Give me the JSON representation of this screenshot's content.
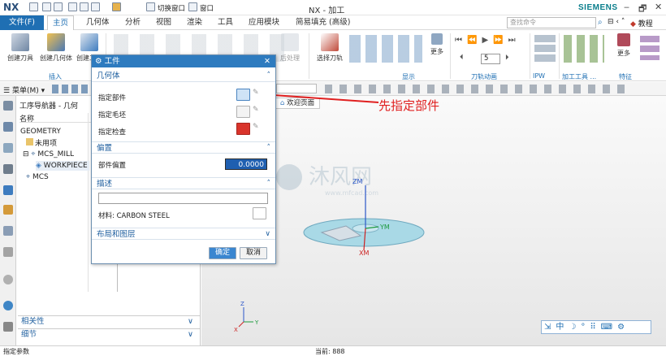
{
  "app": {
    "logo": "NX",
    "title": "NX - 加工",
    "brand": "SIEMENS",
    "quick_access": {
      "switch_window": "切换窗口",
      "window": "窗口"
    },
    "window_controls": [
      "‒",
      "🗗",
      "✕"
    ]
  },
  "menubar": {
    "tabs": [
      "文件(F)",
      "主页",
      "几何体",
      "分析",
      "视图",
      "渲染",
      "工具",
      "应用模块",
      "简易填充 (高级)"
    ],
    "search_placeholder": "查找命令",
    "tutorial": "教程"
  },
  "ribbon": {
    "buttons": [
      "创建刀具",
      "创建几何体",
      "创建工序",
      "后处理",
      "选择刀轨",
      "更多",
      "更多",
      "加工工具 ..."
    ],
    "groups": [
      "插入",
      "显示",
      "刀轨动画",
      "IPW",
      "加工工具 ...",
      "特征"
    ],
    "spinner_value": "5"
  },
  "toolbar2": {
    "menu": "菜单(M)"
  },
  "navigator": {
    "title": "工序导航器 - 几何",
    "column": "名称",
    "rows": [
      "GEOMETRY",
      "未用项",
      "MCS_MILL",
      "WORKPIECE",
      "MCS"
    ],
    "bottom_sections": [
      "相关性",
      "细节"
    ]
  },
  "graphics": {
    "tab": "欢迎页面",
    "axis_labels": [
      "ZM",
      "YM",
      "XM",
      "Z",
      "X",
      "Y"
    ],
    "annotation": "先指定部件"
  },
  "dialog": {
    "title": "工件",
    "sections": {
      "geometry": "几何体",
      "offset": "偏置",
      "description": "描述",
      "layout": "布局和图层"
    },
    "rows": {
      "part": "指定部件",
      "blank": "指定毛坯",
      "check": "指定检查",
      "part_offset": "部件偏置"
    },
    "part_offset_value": "0.0000",
    "material": "材料: CARBON STEEL",
    "ok": "确定",
    "cancel": "取消"
  },
  "status": {
    "left": "指定参数",
    "center": "当前: 888"
  },
  "colors": {
    "accent": "#1f6fb3",
    "annotation": "#e02020",
    "disc": "#a9d9e6"
  }
}
